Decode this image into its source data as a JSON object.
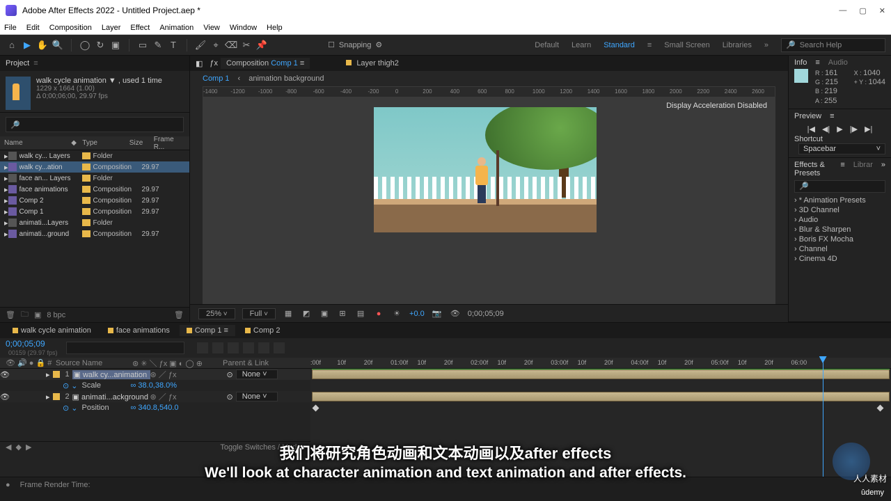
{
  "titlebar": {
    "title": "Adobe After Effects 2022 - Untitled Project.aep *"
  },
  "menubar": [
    "File",
    "Edit",
    "Composition",
    "Layer",
    "Effect",
    "Animation",
    "View",
    "Window",
    "Help"
  ],
  "toolbar": {
    "snapping": "Snapping",
    "workspaces": [
      "Default",
      "Learn",
      "Standard",
      "Small Screen",
      "Libraries"
    ],
    "active_workspace": "Standard",
    "search_placeholder": "Search Help"
  },
  "project": {
    "panel_label": "Project",
    "meta_name": "walk cycle animation ▼ , used 1 time",
    "meta_dims": "1229 x 1664 (1.00)",
    "meta_dur": "Δ 0;00;06;00, 29.97 fps",
    "cols": {
      "name": "Name",
      "type": "Type",
      "size": "Size",
      "frame": "Frame R..."
    },
    "rows": [
      {
        "name": "walk cy... Layers",
        "type": "Folder",
        "fr": "",
        "icon": "folder"
      },
      {
        "name": "walk cy...ation",
        "type": "Composition",
        "fr": "29.97",
        "icon": "comp",
        "sel": true
      },
      {
        "name": "face an... Layers",
        "type": "Folder",
        "fr": "",
        "icon": "folder"
      },
      {
        "name": "face animations",
        "type": "Composition",
        "fr": "29.97",
        "icon": "comp"
      },
      {
        "name": "Comp 2",
        "type": "Composition",
        "fr": "29.97",
        "icon": "comp"
      },
      {
        "name": "Comp 1",
        "type": "Composition",
        "fr": "29.97",
        "icon": "comp"
      },
      {
        "name": "animati...Layers",
        "type": "Folder",
        "fr": "",
        "icon": "folder"
      },
      {
        "name": "animati...ground",
        "type": "Composition",
        "fr": "29.97",
        "icon": "comp"
      }
    ],
    "footer_bpc": "8 bpc"
  },
  "comp_panel": {
    "tab_prefix": "Composition",
    "tab_name": "Comp 1",
    "layer_tab_prefix": "Layer",
    "layer_tab_name": "thigh2",
    "breadcrumb": [
      "Comp 1",
      "animation background"
    ],
    "ruler_ticks": [
      "-1400",
      "-1200",
      "-1000",
      "-800",
      "-600",
      "-400",
      "-200",
      "0",
      "200",
      "400",
      "600",
      "800",
      "1000",
      "1200",
      "1400",
      "1600",
      "1800",
      "2000",
      "2200",
      "2400",
      "2600"
    ],
    "accel_msg": "Display Acceleration Disabled",
    "footer": {
      "zoom": "25%",
      "res": "Full",
      "exposure": "+0.0",
      "time": "0;00;05;09"
    }
  },
  "right": {
    "info_label": "Info",
    "audio_label": "Audio",
    "info": {
      "R": "161",
      "G": "215",
      "B": "219",
      "A": "255",
      "X": "1040",
      "Y": "1044"
    },
    "preview_label": "Preview",
    "shortcut_label": "Shortcut",
    "shortcut_value": "Spacebar",
    "ep_label": "Effects & Presets",
    "libr_label": "Librar",
    "ep_items": [
      "* Animation Presets",
      "3D Channel",
      "Audio",
      "Blur & Sharpen",
      "Boris FX Mocha",
      "Channel",
      "Cinema 4D"
    ]
  },
  "timeline": {
    "tabs": [
      "walk cycle animation",
      "face animations",
      "Comp 1",
      "Comp 2"
    ],
    "active_tab": "Comp 1",
    "current_time": "0;00;05;09",
    "current_sub": "00159 (29.97 fps)",
    "col_source": "Source Name",
    "col_parent": "Parent & Link",
    "layers": [
      {
        "num": "1",
        "name": "walk cy...animation",
        "sel": true,
        "parent": "None",
        "props": [
          {
            "name": "Scale",
            "value": "38.0,38.0%"
          }
        ]
      },
      {
        "num": "2",
        "name": "animati...ackground",
        "sel": false,
        "parent": "None",
        "props": [
          {
            "name": "Position",
            "value": "340.8,540.0"
          }
        ]
      }
    ],
    "ruler": [
      {
        "l": ":00f",
        "p": 0
      },
      {
        "l": "10f",
        "p": 4.6
      },
      {
        "l": "20f",
        "p": 9.2
      },
      {
        "l": "01:00f",
        "p": 13.8
      },
      {
        "l": "10f",
        "p": 18.4
      },
      {
        "l": "20f",
        "p": 23.0
      },
      {
        "l": "02:00f",
        "p": 27.6
      },
      {
        "l": "10f",
        "p": 32.2
      },
      {
        "l": "20f",
        "p": 36.8
      },
      {
        "l": "03:00f",
        "p": 41.4
      },
      {
        "l": "10f",
        "p": 46.0
      },
      {
        "l": "20f",
        "p": 50.6
      },
      {
        "l": "04:00f",
        "p": 55.2
      },
      {
        "l": "10f",
        "p": 59.8
      },
      {
        "l": "20f",
        "p": 64.4
      },
      {
        "l": "05:00f",
        "p": 69.0
      },
      {
        "l": "10f",
        "p": 73.6
      },
      {
        "l": "20f",
        "p": 78.2
      },
      {
        "l": "06:00",
        "p": 82.8
      }
    ],
    "playhead_pct": 88.2,
    "toggle_label": "Toggle Switches / Modes"
  },
  "statusbar": {
    "frame_render": "Frame Render Time:"
  },
  "subtitles": {
    "cn": "我们将研究角色动画和文本动画以及after effects",
    "en": "We'll look at character animation and text animation and after effects."
  },
  "branding": {
    "rrcg": "人人素材",
    "udemy": "ûdemy"
  }
}
